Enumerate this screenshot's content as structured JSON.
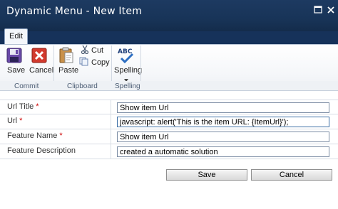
{
  "window": {
    "title": "Dynamic Menu - New Item"
  },
  "ribbon": {
    "active_tab": "Edit",
    "groups": [
      {
        "label": "Commit",
        "buttons": [
          {
            "label": "Save",
            "icon": "save-disk-icon"
          },
          {
            "label": "Cancel",
            "icon": "cancel-icon"
          }
        ]
      },
      {
        "label": "Clipboard",
        "buttons": [
          {
            "label": "Paste",
            "icon": "paste-icon"
          },
          {
            "label": "Cut",
            "icon": "scissors-icon"
          },
          {
            "label": "Copy",
            "icon": "copy-icon"
          }
        ]
      },
      {
        "label": "Spelling",
        "buttons": [
          {
            "label": "Spelling",
            "icon": "spell-check-icon"
          }
        ]
      }
    ]
  },
  "form": {
    "fields": [
      {
        "label": "Url Title",
        "required": "*",
        "value": "Show item Url"
      },
      {
        "label": "Url",
        "required": "*",
        "value": "javascript: alert('This is the item URL: {ItemUrl}');"
      },
      {
        "label": "Feature Name",
        "required": "*",
        "value": "Show item Url"
      },
      {
        "label": "Feature Description",
        "required": "",
        "value": "created a automatic solution"
      }
    ],
    "save_label": "Save",
    "cancel_label": "Cancel"
  },
  "colors": {
    "titlebar": "#183458",
    "required_marker": "#cc0000",
    "ribbon_bg": "#f4f6f9"
  }
}
